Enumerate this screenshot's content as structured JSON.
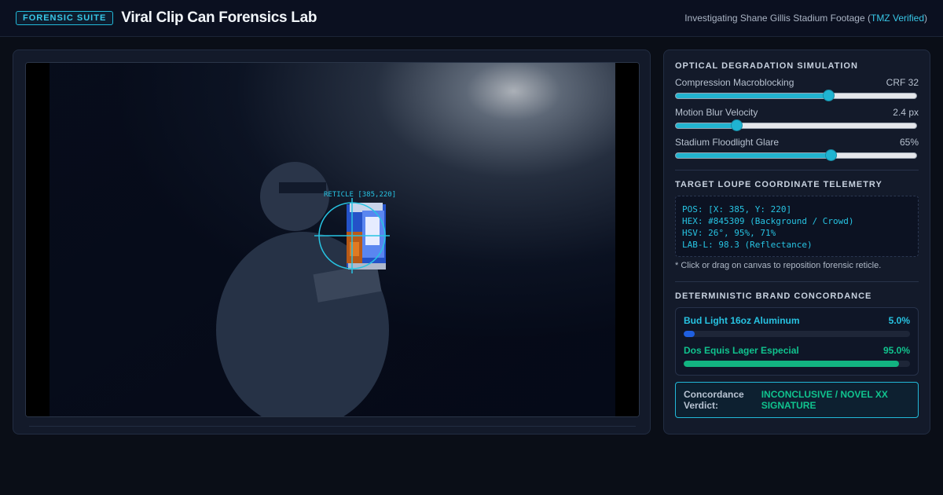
{
  "header": {
    "badge": "FORENSIC SUITE",
    "title": "Viral Clip Can Forensics Lab",
    "subtitle_prefix": "Investigating Shane Gillis Stadium Footage (",
    "subtitle_link": "TMZ Verified",
    "subtitle_suffix": ")"
  },
  "viewer": {
    "reticle_label": "RETICLE [385,220]"
  },
  "degradation": {
    "section_title": "OPTICAL DEGRADATION SIMULATION",
    "sliders": [
      {
        "label": "Compression Macroblocking",
        "value_text": "CRF 32",
        "fraction": 0.635
      },
      {
        "label": "Motion Blur Velocity",
        "value_text": "2.4 px",
        "fraction": 0.25
      },
      {
        "label": "Stadium Floodlight Glare",
        "value_text": "65%",
        "fraction": 0.645
      }
    ]
  },
  "telemetry": {
    "section_title": "TARGET LOUPE COORDINATE TELEMETRY",
    "lines": [
      "POS: [X: 385, Y: 220]",
      "HEX: #845309 (Background / Crowd)",
      "HSV: 26°, 95%, 71%",
      "LAB-L: 98.3 (Reflectance)"
    ],
    "hint": "* Click or drag on canvas to reposition forensic reticle."
  },
  "concordance": {
    "section_title": "DETERMINISTIC BRAND CONCORDANCE",
    "brands": [
      {
        "name": "Bud Light 16oz Aluminum",
        "percent_text": "5.0%",
        "value": 5.0,
        "color": "#1f5fe0",
        "text_color": "#27c3e2"
      },
      {
        "name": "Dos Equis Lager Especial",
        "percent_text": "95.0%",
        "value": 95.0,
        "color": "#12b481",
        "text_color": "#10c38e"
      }
    ],
    "verdict_label": "Concordance Verdict:",
    "verdict_value": "INCONCLUSIVE / NOVEL XX SIGNATURE"
  },
  "colors": {
    "accent": "#22b8d8",
    "success": "#10c38e",
    "background": "#0a0e17"
  }
}
